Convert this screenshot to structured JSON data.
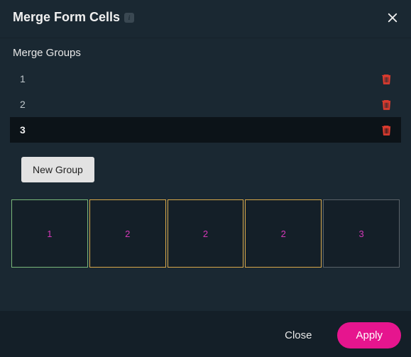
{
  "header": {
    "title": "Merge Form Cells",
    "info_symbol": "i"
  },
  "section_title": "Merge Groups",
  "groups": [
    {
      "label": "1",
      "selected": false
    },
    {
      "label": "2",
      "selected": false
    },
    {
      "label": "3",
      "selected": true
    }
  ],
  "new_group_label": "New Group",
  "cells": [
    {
      "label": "1",
      "color": "green"
    },
    {
      "label": "2",
      "color": "yellow"
    },
    {
      "label": "2",
      "color": "yellow"
    },
    {
      "label": "2",
      "color": "yellow"
    },
    {
      "label": "3",
      "color": "gray"
    }
  ],
  "footer": {
    "close_label": "Close",
    "apply_label": "Apply"
  }
}
